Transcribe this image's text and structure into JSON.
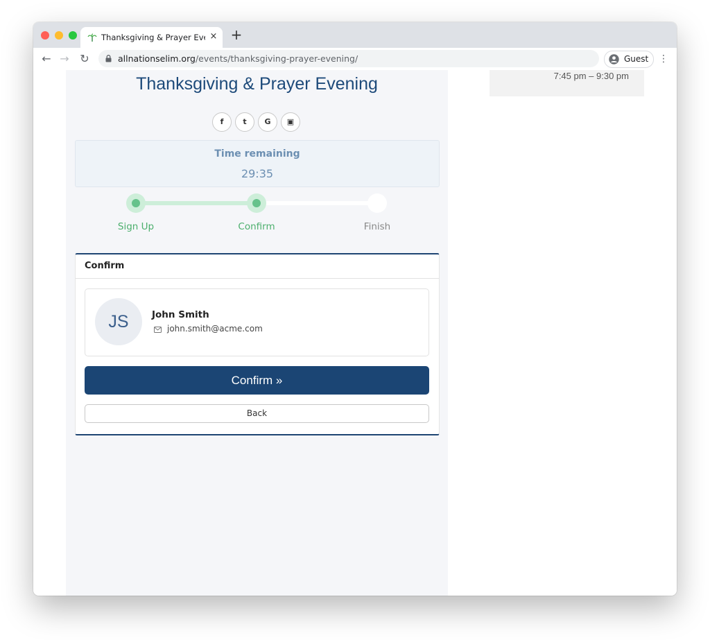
{
  "browser": {
    "tab_title": "Thanksgiving & Prayer Evening",
    "tab_close": "×",
    "new_tab": "+",
    "url_domain": "allnationselim.org",
    "url_path": "/events/thanksgiving-prayer-evening/",
    "profile_label": "Guest",
    "back_glyph": "←",
    "forward_glyph": "→",
    "reload_glyph": "↻",
    "menu_glyph": "⋮"
  },
  "event": {
    "title": "Thanksgiving & Prayer Evening",
    "side_time": "7:45 pm – 9:30 pm",
    "share_icons": [
      {
        "icon": "facebook-icon",
        "glyph": "f"
      },
      {
        "icon": "twitter-icon",
        "glyph": "t"
      },
      {
        "icon": "google-icon",
        "glyph": "G"
      },
      {
        "icon": "calendar-icon",
        "glyph": "▣"
      }
    ]
  },
  "timer": {
    "label": "Time remaining",
    "value": "29:35"
  },
  "steps": [
    {
      "label": "Sign Up",
      "state": "done"
    },
    {
      "label": "Confirm",
      "state": "current"
    },
    {
      "label": "Finish",
      "state": "todo"
    }
  ],
  "confirm_card": {
    "header": "Confirm",
    "attendee": {
      "initials": "JS",
      "name": "John Smith",
      "email": "john.smith@acme.com"
    },
    "confirm_label": "Confirm »",
    "back_label": "Back"
  },
  "colors": {
    "brand_navy": "#1b4574",
    "title_blue": "#1d4a7a",
    "step_green": "#66c28b",
    "step_green_light": "#cdeed9"
  }
}
